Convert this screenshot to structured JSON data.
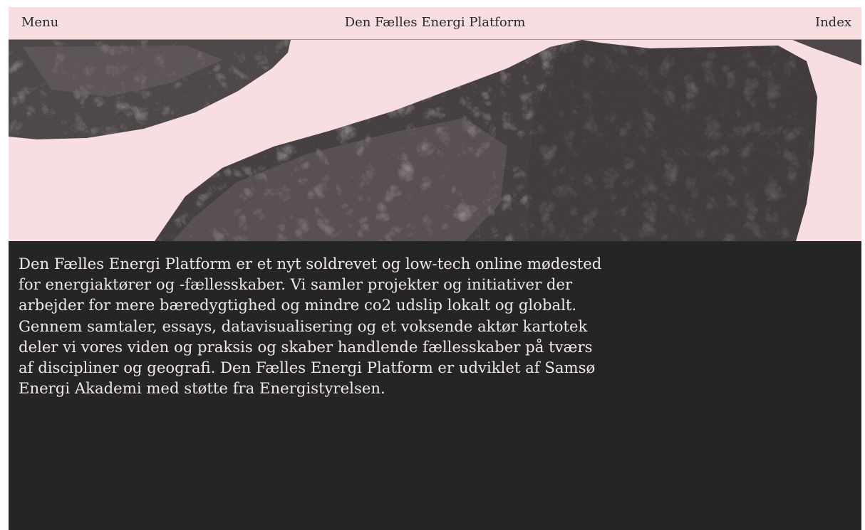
{
  "header": {
    "menu_label": "Menu",
    "site_title": "Den Fælles Energi Platform",
    "index_label": "Index"
  },
  "hero": {
    "image_semantic": "stones-image",
    "background_color": "#f8dde1"
  },
  "main": {
    "intro_text": "Den Fælles Energi Platform er et nyt soldrevet og low-tech online mødested for energiaktører og -fællesskaber. Vi samler projekter og initiativer der arbejder for mere bæredygtighed og mindre co2 udslip lokalt og globalt. Gennem samtaler, essays, datavisualisering og et voksende aktør kartotek deler vi vores viden og praksis og skaber handlende fællesskaber på tværs af discipliner og geografi. Den Fælles Energi Platform er udviklet af Samsø Energi Akademi med støtte fra Energistyrelsen."
  },
  "colors": {
    "page_background": "#252525",
    "header_background": "#f8dde1",
    "text_dark": "#2a2a2a",
    "text_light": "#f1e6e6"
  }
}
